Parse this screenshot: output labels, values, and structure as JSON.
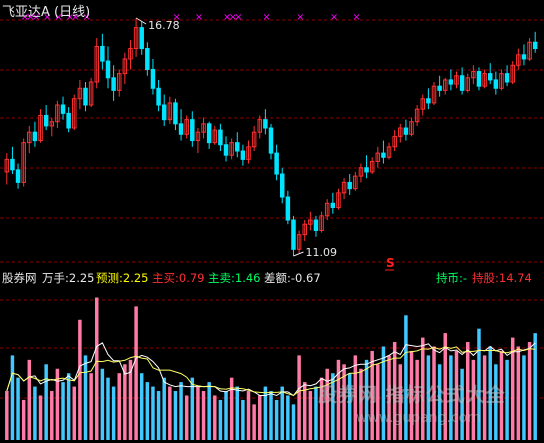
{
  "header": {
    "title": "飞亚达A (日线)"
  },
  "indicator": {
    "name": "股券网",
    "wanshou": "万手:2.25",
    "yuce": "预测:2.25",
    "zhumai_buy": "主买:0.79",
    "zhumai_sell": "主卖:1.46",
    "chae": "差额:-0.67",
    "chibi": "持币:-",
    "chigu": "持股:14.74"
  },
  "watermark": {
    "line1": "股券网 指标公式大全",
    "line2": "www.gupang.com"
  },
  "colors": {
    "up": "#ff3030",
    "down": "#00e5ff",
    "grid": "#8b0000",
    "signal": "#ff00ff",
    "vol_up": "#ff7aa6",
    "vol_down": "#40c8ff",
    "text": "#e8e8e8",
    "sell_signal": "#ff2020"
  },
  "chart_data": {
    "type": "candlestick",
    "annotations": [
      {
        "label": "16.78",
        "type": "high"
      },
      {
        "label": "11.09",
        "type": "low"
      },
      {
        "label": "S",
        "type": "sell-signal"
      }
    ],
    "signal_marks_text": "×",
    "ohlc": [
      [
        13.1,
        13.55,
        12.8,
        13.4
      ],
      [
        13.4,
        13.7,
        13.05,
        13.15
      ],
      [
        13.15,
        13.3,
        12.7,
        12.85
      ],
      [
        12.85,
        13.9,
        12.75,
        13.8
      ],
      [
        13.8,
        14.2,
        13.55,
        14.05
      ],
      [
        14.05,
        14.3,
        13.7,
        13.85
      ],
      [
        13.85,
        14.6,
        13.8,
        14.45
      ],
      [
        14.45,
        14.7,
        14.1,
        14.2
      ],
      [
        14.2,
        14.4,
        13.95,
        14.3
      ],
      [
        14.3,
        14.8,
        14.15,
        14.7
      ],
      [
        14.7,
        14.9,
        14.35,
        14.5
      ],
      [
        14.5,
        14.65,
        14.05,
        14.15
      ],
      [
        14.15,
        14.95,
        14.1,
        14.85
      ],
      [
        14.85,
        15.3,
        14.6,
        15.1
      ],
      [
        15.1,
        15.25,
        14.55,
        14.7
      ],
      [
        14.7,
        15.35,
        14.65,
        15.25
      ],
      [
        15.25,
        16.3,
        15.1,
        16.1
      ],
      [
        16.1,
        16.4,
        15.55,
        15.75
      ],
      [
        15.75,
        16.1,
        15.1,
        15.35
      ],
      [
        15.35,
        15.65,
        14.8,
        15.05
      ],
      [
        15.05,
        15.55,
        14.9,
        15.45
      ],
      [
        15.45,
        15.95,
        15.2,
        15.8
      ],
      [
        15.8,
        16.25,
        15.55,
        16.05
      ],
      [
        16.05,
        16.78,
        15.85,
        16.55
      ],
      [
        16.55,
        16.7,
        15.9,
        16.05
      ],
      [
        16.05,
        16.2,
        15.4,
        15.55
      ],
      [
        15.55,
        15.8,
        14.95,
        15.1
      ],
      [
        15.1,
        15.3,
        14.55,
        14.7
      ],
      [
        14.7,
        14.95,
        14.2,
        14.35
      ],
      [
        14.35,
        14.9,
        14.25,
        14.75
      ],
      [
        14.75,
        14.85,
        14.1,
        14.25
      ],
      [
        14.25,
        14.6,
        13.85,
        14.0
      ],
      [
        14.0,
        14.45,
        13.9,
        14.35
      ],
      [
        14.35,
        14.55,
        13.7,
        13.85
      ],
      [
        13.85,
        14.15,
        13.55,
        14.05
      ],
      [
        14.05,
        14.4,
        13.9,
        14.25
      ],
      [
        14.25,
        14.3,
        13.65,
        13.8
      ],
      [
        13.8,
        14.2,
        13.75,
        14.1
      ],
      [
        14.1,
        14.25,
        13.6,
        13.75
      ],
      [
        13.75,
        13.95,
        13.35,
        13.5
      ],
      [
        13.5,
        13.9,
        13.4,
        13.8
      ],
      [
        13.8,
        14.05,
        13.45,
        13.6
      ],
      [
        13.6,
        13.75,
        13.25,
        13.4
      ],
      [
        13.4,
        13.85,
        13.3,
        13.7
      ],
      [
        13.7,
        14.2,
        13.6,
        14.05
      ],
      [
        14.05,
        14.45,
        13.9,
        14.35
      ],
      [
        14.35,
        14.6,
        14.0,
        14.15
      ],
      [
        14.15,
        14.25,
        13.4,
        13.55
      ],
      [
        13.55,
        13.75,
        12.9,
        13.05
      ],
      [
        13.05,
        13.2,
        12.35,
        12.5
      ],
      [
        12.5,
        12.65,
        11.85,
        11.95
      ],
      [
        11.95,
        12.05,
        11.09,
        11.25
      ],
      [
        11.25,
        11.7,
        11.15,
        11.6
      ],
      [
        11.6,
        11.95,
        11.45,
        11.85
      ],
      [
        11.85,
        12.15,
        11.7,
        11.95
      ],
      [
        11.95,
        12.05,
        11.55,
        11.7
      ],
      [
        11.7,
        12.15,
        11.65,
        12.05
      ],
      [
        12.05,
        12.45,
        11.95,
        12.35
      ],
      [
        12.35,
        12.6,
        12.1,
        12.25
      ],
      [
        12.25,
        12.7,
        12.2,
        12.6
      ],
      [
        12.6,
        12.95,
        12.45,
        12.85
      ],
      [
        12.85,
        13.05,
        12.55,
        12.7
      ],
      [
        12.7,
        13.1,
        12.65,
        13.0
      ],
      [
        13.0,
        13.3,
        12.85,
        13.2
      ],
      [
        13.2,
        13.5,
        12.95,
        13.1
      ],
      [
        13.1,
        13.45,
        13.05,
        13.35
      ],
      [
        13.35,
        13.7,
        13.2,
        13.55
      ],
      [
        13.55,
        13.85,
        13.3,
        13.45
      ],
      [
        13.45,
        13.8,
        13.4,
        13.7
      ],
      [
        13.7,
        14.1,
        13.6,
        13.95
      ],
      [
        13.95,
        14.25,
        13.8,
        14.15
      ],
      [
        14.15,
        14.35,
        13.85,
        14.0
      ],
      [
        14.0,
        14.4,
        13.95,
        14.3
      ],
      [
        14.3,
        14.7,
        14.2,
        14.6
      ],
      [
        14.6,
        14.95,
        14.45,
        14.85
      ],
      [
        14.85,
        15.1,
        14.6,
        14.75
      ],
      [
        14.75,
        15.25,
        14.7,
        15.15
      ],
      [
        15.15,
        15.4,
        14.9,
        15.05
      ],
      [
        15.05,
        15.35,
        14.95,
        15.3
      ],
      [
        15.3,
        15.55,
        15.05,
        15.2
      ],
      [
        15.2,
        15.5,
        15.1,
        15.4
      ],
      [
        15.4,
        15.6,
        14.95,
        15.05
      ],
      [
        15.05,
        15.45,
        15.0,
        15.35
      ],
      [
        15.35,
        15.65,
        15.2,
        15.5
      ],
      [
        15.5,
        15.6,
        15.05,
        15.15
      ],
      [
        15.15,
        15.55,
        15.1,
        15.45
      ],
      [
        15.45,
        15.7,
        15.2,
        15.3
      ],
      [
        15.3,
        15.5,
        14.95,
        15.1
      ],
      [
        15.1,
        15.55,
        15.05,
        15.45
      ],
      [
        15.45,
        15.65,
        15.15,
        15.25
      ],
      [
        15.25,
        15.75,
        15.2,
        15.65
      ],
      [
        15.65,
        16.05,
        15.55,
        15.9
      ],
      [
        15.9,
        16.15,
        15.65,
        15.8
      ],
      [
        15.8,
        16.3,
        15.75,
        16.2
      ],
      [
        16.2,
        16.45,
        15.95,
        16.05
      ]
    ],
    "volume": [
      0.55,
      0.95,
      0.7,
      0.45,
      0.9,
      0.6,
      0.5,
      0.85,
      0.55,
      0.8,
      0.65,
      0.75,
      0.6,
      1.35,
      0.95,
      0.75,
      1.6,
      0.8,
      0.7,
      0.6,
      0.75,
      0.85,
      0.9,
      1.5,
      0.75,
      0.65,
      0.6,
      0.55,
      0.7,
      0.6,
      0.55,
      0.65,
      0.5,
      0.7,
      0.6,
      0.55,
      0.65,
      0.5,
      0.45,
      0.55,
      0.7,
      0.6,
      0.45,
      0.55,
      0.4,
      0.5,
      0.6,
      0.55,
      0.45,
      0.6,
      0.5,
      0.4,
      0.95,
      0.65,
      0.55,
      0.6,
      0.7,
      0.8,
      0.75,
      0.9,
      0.85,
      0.75,
      0.95,
      0.8,
      0.9,
      1.0,
      0.85,
      1.05,
      0.95,
      1.1,
      0.85,
      1.4,
      1.0,
      0.9,
      1.15,
      0.95,
      1.05,
      0.85,
      1.2,
      0.95,
      1.0,
      0.8,
      1.1,
      0.9,
      1.25,
      0.95,
      1.05,
      0.85,
      1.0,
      0.9,
      1.15,
      1.05,
      0.95,
      1.1,
      1.2
    ]
  }
}
